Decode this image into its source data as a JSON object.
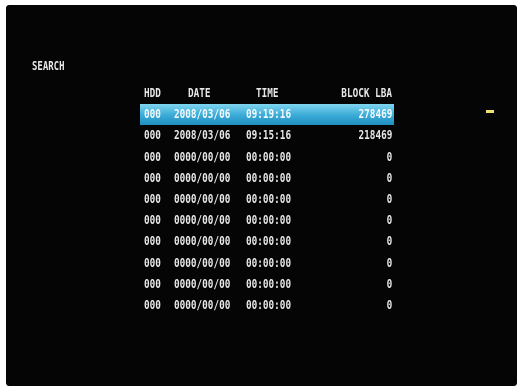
{
  "screen": {
    "title": "SEARCH"
  },
  "columns": {
    "hdd": "HDD",
    "date": "DATE",
    "time": "TIME",
    "lba": "BLOCK LBA"
  },
  "rows": [
    {
      "hdd": "000",
      "date": "2008/03/06",
      "time": "09:19:16",
      "lba": "278469",
      "selected": true
    },
    {
      "hdd": "000",
      "date": "2008/03/06",
      "time": "09:15:16",
      "lba": "218469"
    },
    {
      "hdd": "000",
      "date": "0000/00/00",
      "time": "00:00:00",
      "lba": "0"
    },
    {
      "hdd": "000",
      "date": "0000/00/00",
      "time": "00:00:00",
      "lba": "0"
    },
    {
      "hdd": "000",
      "date": "0000/00/00",
      "time": "00:00:00",
      "lba": "0"
    },
    {
      "hdd": "000",
      "date": "0000/00/00",
      "time": "00:00:00",
      "lba": "0"
    },
    {
      "hdd": "000",
      "date": "0000/00/00",
      "time": "00:00:00",
      "lba": "0"
    },
    {
      "hdd": "000",
      "date": "0000/00/00",
      "time": "00:00:00",
      "lba": "0"
    },
    {
      "hdd": "000",
      "date": "0000/00/00",
      "time": "00:00:00",
      "lba": "0"
    },
    {
      "hdd": "000",
      "date": "0000/00/00",
      "time": "00:00:00",
      "lba": "0"
    }
  ],
  "colors": {
    "background": "#050505",
    "text": "#e8e8e8",
    "selection": "#3aa9d6",
    "cursor": "#f0e070"
  }
}
